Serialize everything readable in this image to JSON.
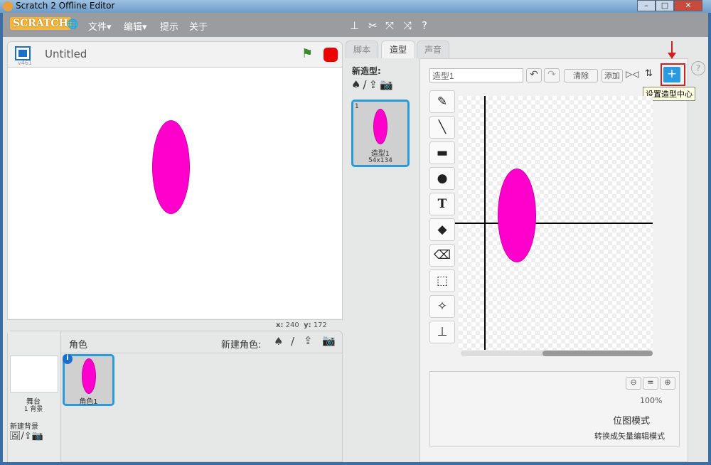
{
  "window": {
    "title": "Scratch 2 Offline Editor",
    "minimize": "–",
    "maximize": "□",
    "close": "✕"
  },
  "menu": {
    "logo": "SCRATCH",
    "items": [
      "文件▾",
      "编辑▾",
      "提示",
      "关于"
    ]
  },
  "stage": {
    "title": "Untitled",
    "version": "v461",
    "x_label": "x:",
    "x_value": "240",
    "y_label": "y:",
    "y_value": "172"
  },
  "sprites": {
    "header": "角色",
    "new_sprite_label": "新建角色:",
    "stage_label": "舞台",
    "backdrop_count": "1 背景",
    "new_backdrop_label": "新建背景",
    "items": [
      {
        "name": "角色1"
      }
    ]
  },
  "tabs": [
    {
      "label": "脚本"
    },
    {
      "label": "造型"
    },
    {
      "label": "声音"
    }
  ],
  "costumes": {
    "new_label": "新造型:",
    "items": [
      {
        "index": "1",
        "name": "造型1",
        "size": "54x134"
      }
    ]
  },
  "editor": {
    "costume_name": "造型1",
    "clear": "清除",
    "add": "添加",
    "tooltip": "设置造型中心",
    "zoom": "100%",
    "mode": "位图模式",
    "convert": "转换成矢量编辑模式",
    "help": "?"
  },
  "colors": {
    "accent": "#1e90ff",
    "fill": "#ff00cc"
  }
}
